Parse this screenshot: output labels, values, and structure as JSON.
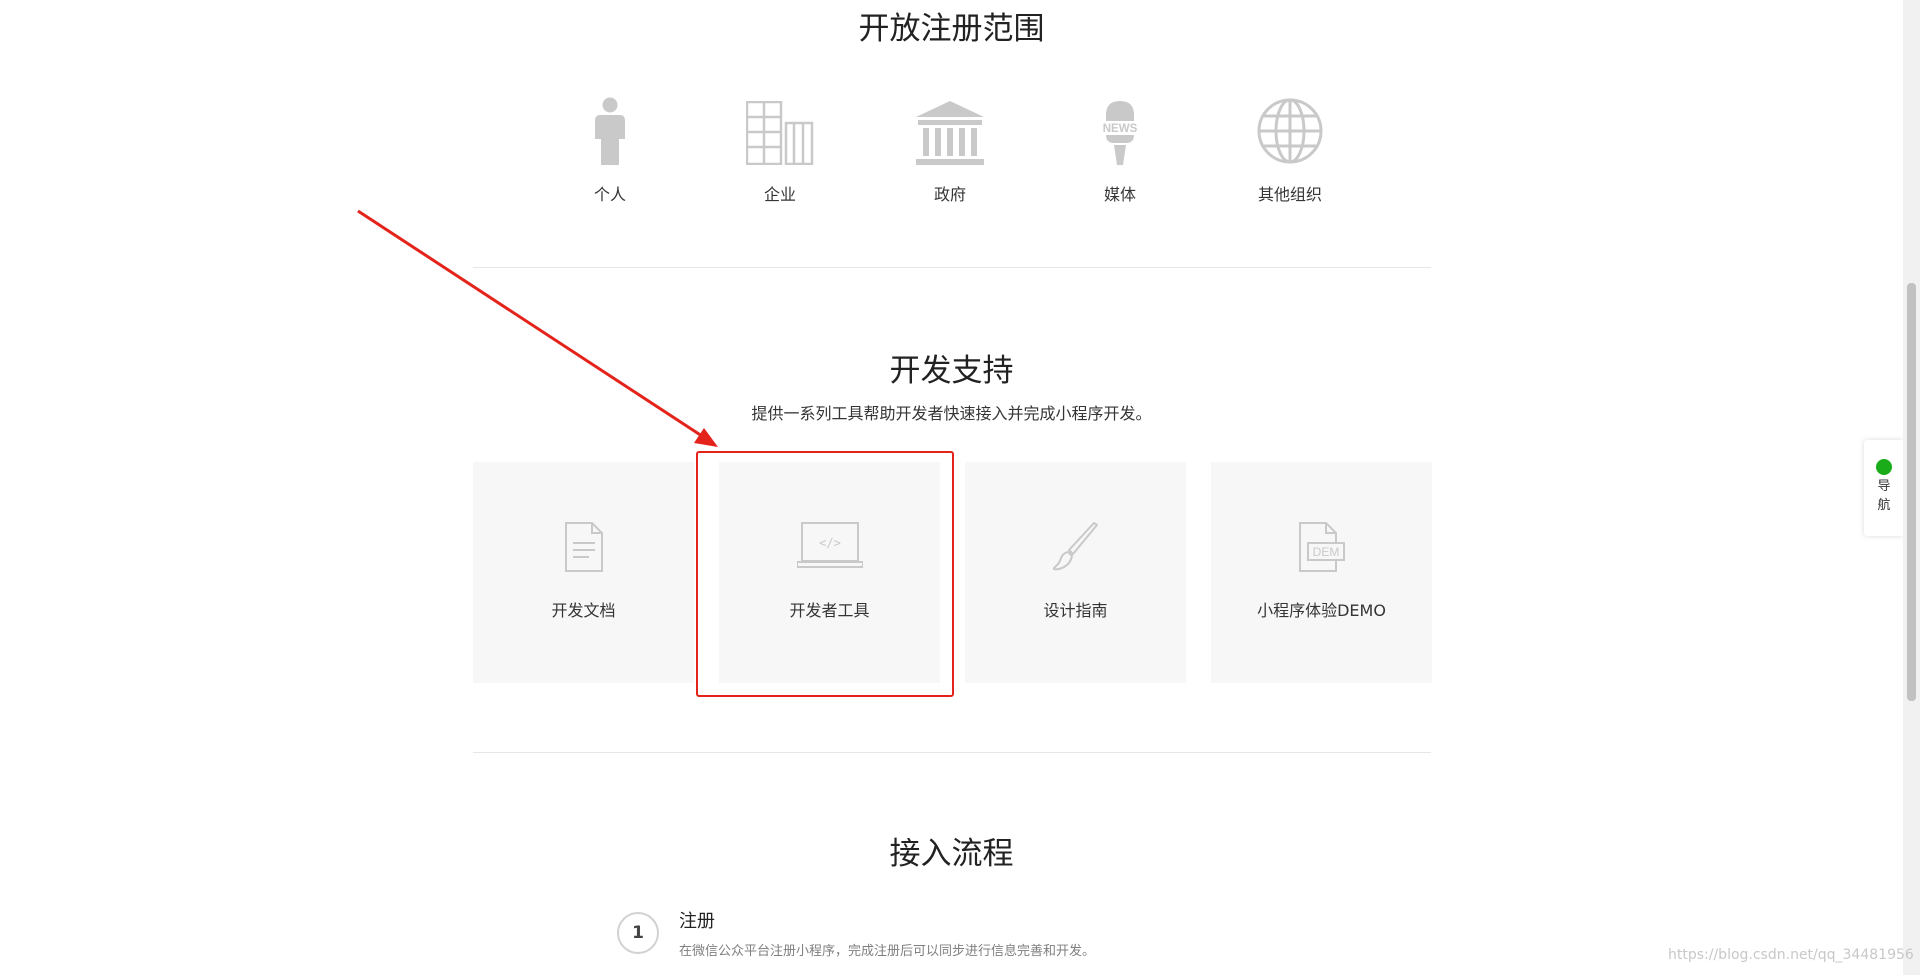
{
  "scope": {
    "title": "开放注册范围",
    "items": [
      {
        "label": "个人",
        "icon": "person-icon"
      },
      {
        "label": "企业",
        "icon": "building-icon"
      },
      {
        "label": "政府",
        "icon": "government-icon"
      },
      {
        "label": "媒体",
        "icon": "news-microphone-icon"
      },
      {
        "label": "其他组织",
        "icon": "globe-icon"
      }
    ]
  },
  "dev": {
    "title": "开发支持",
    "description": "提供一系列工具帮助开发者快速接入并完成小程序开发。",
    "cards": [
      {
        "label": "开发文档",
        "icon": "document-icon"
      },
      {
        "label": "开发者工具",
        "icon": "laptop-code-icon"
      },
      {
        "label": "设计指南",
        "icon": "brush-icon"
      },
      {
        "label": "小程序体验DEMO",
        "icon": "demo-file-icon",
        "icon_text": "DEM"
      }
    ]
  },
  "flow": {
    "title": "接入流程",
    "steps": [
      {
        "number": "1",
        "title": "注册",
        "description": "在微信公众平台注册小程序，完成注册后可以同步进行信息完善和开发。"
      }
    ]
  },
  "side_nav": {
    "label": "导航"
  },
  "watermark": "https://blog.csdn.net/qq_34481956",
  "colors": {
    "highlight": "#e4231b",
    "icon_gray": "#c9c9c9",
    "card_bg": "#f7f7f7",
    "nav_dot": "#1aad19"
  }
}
